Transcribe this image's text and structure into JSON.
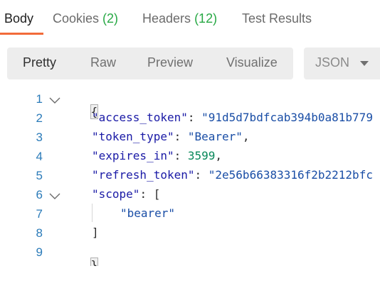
{
  "tabs": {
    "body": {
      "label": "Body"
    },
    "cookies": {
      "label": "Cookies",
      "count": "(2)"
    },
    "headers": {
      "label": "Headers",
      "count": "(12)"
    },
    "test_results": {
      "label": "Test Results"
    }
  },
  "view_modes": {
    "pretty": "Pretty",
    "raw": "Raw",
    "preview": "Preview",
    "visualize": "Visualize"
  },
  "format": {
    "selected": "JSON",
    "icon": "chevron-down-icon"
  },
  "code": {
    "line_numbers": [
      "1",
      "2",
      "3",
      "4",
      "5",
      "6",
      "7",
      "8",
      "9"
    ],
    "open_brace": "{",
    "close_brace": "}",
    "access_token_key": "\"access_token\"",
    "access_token_value": "\"91d5d7bdfcab394b0a81b779",
    "token_type_key": "\"token_type\"",
    "token_type_value": "\"Bearer\"",
    "expires_in_key": "\"expires_in\"",
    "expires_in_value": "3599",
    "refresh_token_key": "\"refresh_token\"",
    "refresh_token_value": "\"2e56b66383316f2b2212bfc",
    "scope_key": "\"scope\"",
    "scope_open": "[",
    "scope_item": "\"bearer\"",
    "scope_close": "]",
    "colon": ": ",
    "comma": ","
  },
  "colors": {
    "accent": "#f26b3a",
    "count_green": "#27a844",
    "line_number_blue": "#2b7bb9",
    "key_color": "#1a1aa6",
    "number_color": "#09885a"
  }
}
